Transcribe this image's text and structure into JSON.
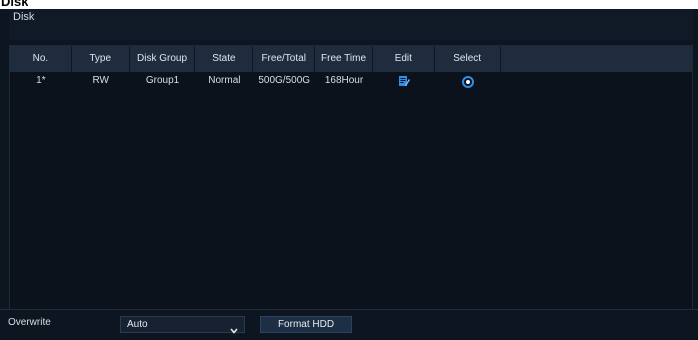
{
  "window": {
    "title": "Disk"
  },
  "panel": {
    "title": "Disk"
  },
  "table": {
    "columns": [
      "No.",
      "Type",
      "Disk Group",
      "State",
      "Free/Total",
      "Free Time",
      "Edit",
      "Select",
      ""
    ],
    "rows": [
      {
        "no": "1*",
        "type": "RW",
        "disk_group": "Group1",
        "state": "Normal",
        "free_total": "500G/500G",
        "free_time": "168Hour",
        "edit_icon": "edit-icon",
        "select_icon": "radio-icon"
      }
    ]
  },
  "footer": {
    "overwrite_label": "Overwrite",
    "overwrite_value": "Auto",
    "format_button": "Format HDD"
  },
  "colors": {
    "background": "#0d1520",
    "header_row": "#1e2c3d",
    "accent": "#2f8fe8"
  }
}
